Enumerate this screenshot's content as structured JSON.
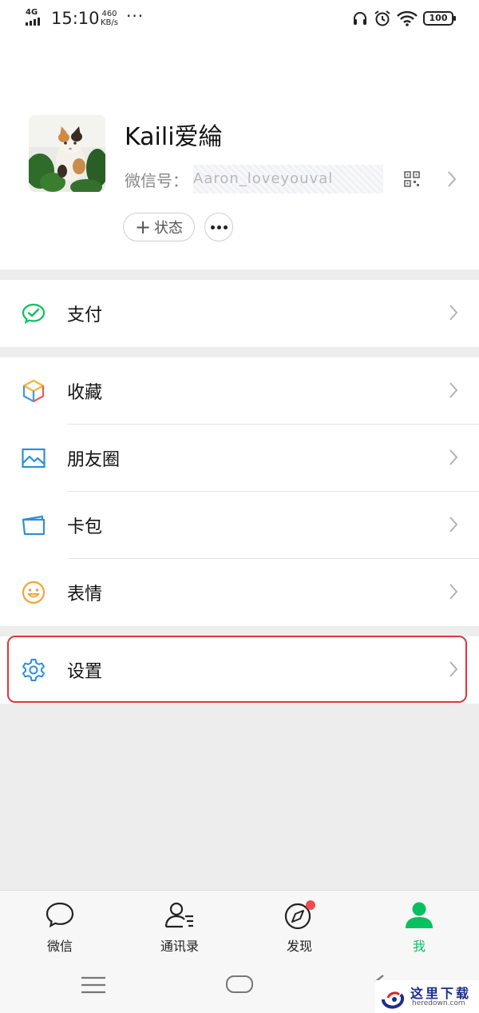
{
  "status_bar": {
    "network": "4G",
    "time": "15:10",
    "speed_value": "460",
    "speed_unit": "KB/s",
    "more": "···",
    "battery": "100",
    "icons": [
      "headphones-icon",
      "alarm-icon",
      "wifi-icon",
      "battery-icon"
    ]
  },
  "profile": {
    "nickname": "Kaili爱綸",
    "wechat_id_label": "微信号：",
    "wechat_id_value": "Aaron_loveyouval",
    "status_button": "状态",
    "status_plus": "+",
    "icons": [
      "avatar-cat-photo",
      "qr-code-icon",
      "chevron-right-icon",
      "more-dots-icon"
    ]
  },
  "menu": {
    "pay": {
      "label": "支付",
      "icon": "wechat-pay-icon",
      "color": "#07c160"
    },
    "favorites": {
      "label": "收藏",
      "icon": "favorites-cube-icon"
    },
    "moments": {
      "label": "朋友圈",
      "icon": "moments-photo-icon",
      "color": "#2e8fd6"
    },
    "cards": {
      "label": "卡包",
      "icon": "card-wallet-icon",
      "color": "#2e8fd6"
    },
    "stickers": {
      "label": "表情",
      "icon": "smiley-face-icon",
      "color": "#f0a63a"
    },
    "settings": {
      "label": "设置",
      "icon": "gear-icon",
      "color": "#2e8fd6",
      "highlighted": true
    }
  },
  "tabbar": {
    "tabs": [
      {
        "label": "微信",
        "icon": "chat-bubble-icon",
        "active": false
      },
      {
        "label": "通讯录",
        "icon": "contacts-icon",
        "active": false
      },
      {
        "label": "发现",
        "icon": "compass-icon",
        "active": false,
        "badge": true
      },
      {
        "label": "我",
        "icon": "person-icon",
        "active": true
      }
    ],
    "active_color": "#07c160"
  },
  "navbar": {
    "icons": [
      "menu-lines-icon",
      "home-pill-icon",
      "back-icon"
    ]
  },
  "watermark": {
    "text": "这里下载",
    "url": "heredown.com"
  },
  "colors": {
    "highlight_border": "#e0353b",
    "badge": "#f04c4c",
    "background": "#ededed"
  }
}
